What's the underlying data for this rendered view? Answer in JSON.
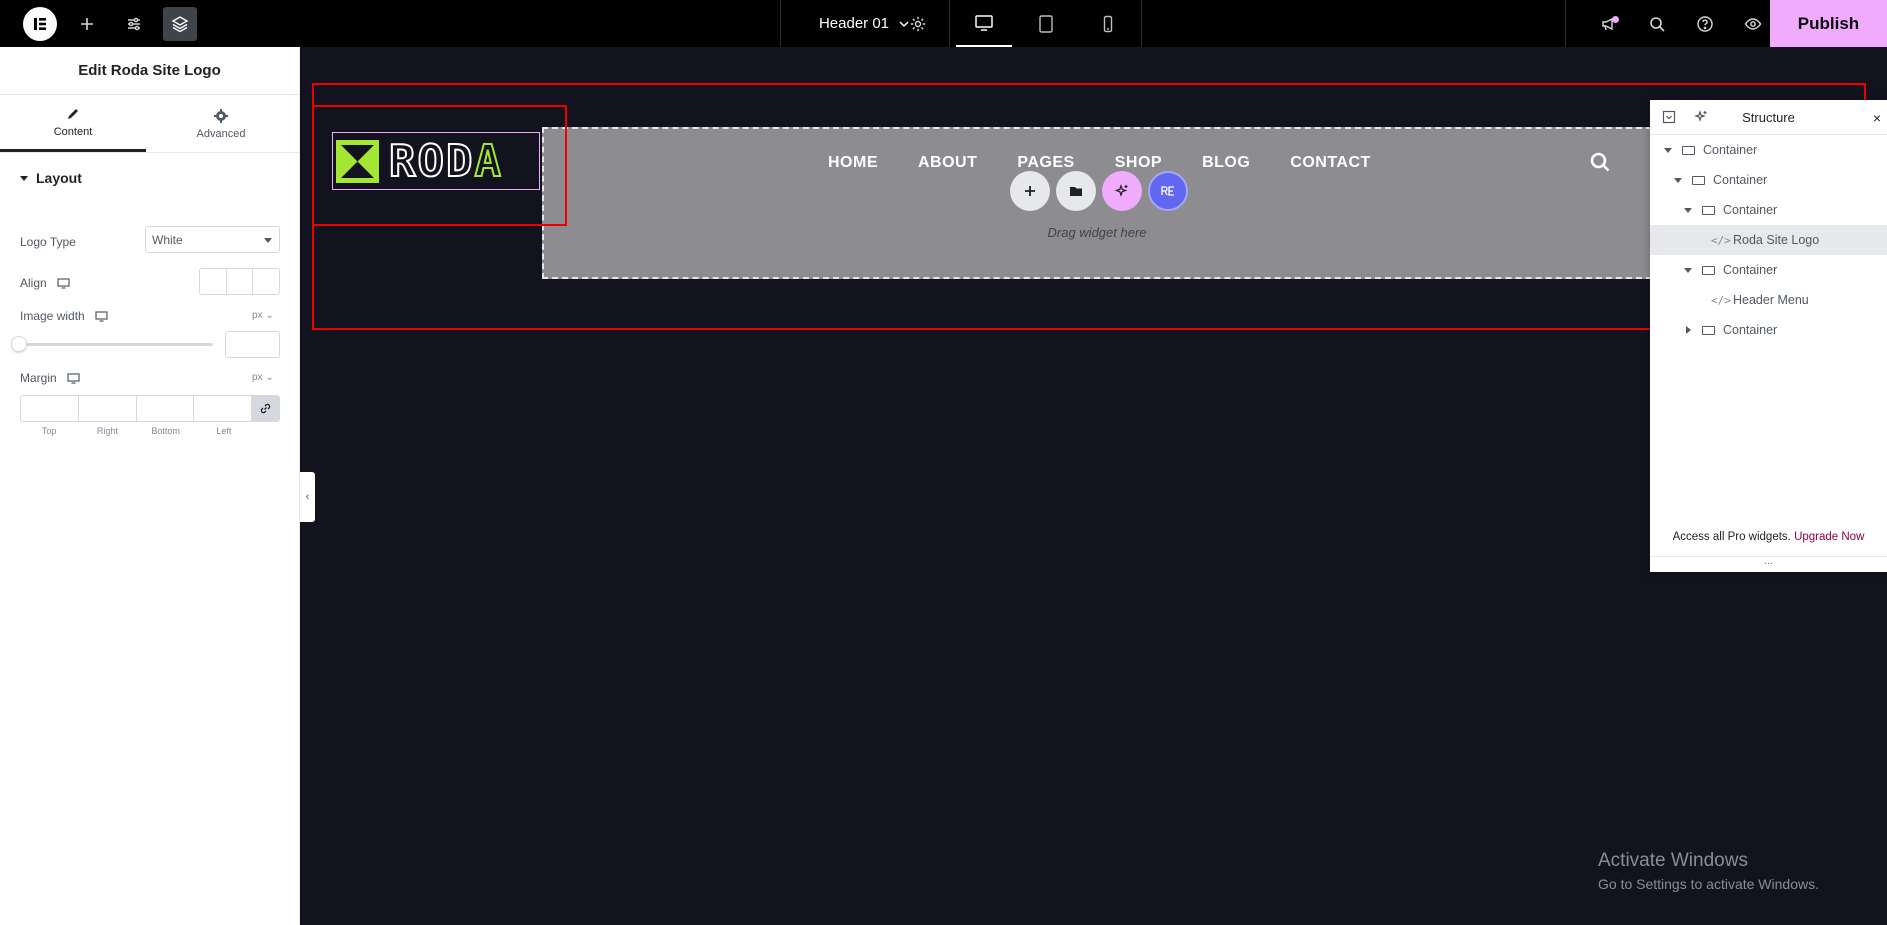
{
  "topbar": {
    "document_title": "Header 01",
    "publish_label": "Publish",
    "icons": [
      "elementor-logo-icon",
      "add-icon",
      "sliders-icon",
      "layers-icon",
      "chevron-down-icon",
      "gear-icon",
      "desktop-icon",
      "tablet-icon",
      "mobile-icon",
      "megaphone-icon",
      "search-icon",
      "help-icon",
      "eye-icon"
    ]
  },
  "panel": {
    "title": "Edit Roda Site Logo",
    "tabs": [
      {
        "label": "Content"
      },
      {
        "label": "Advanced"
      }
    ],
    "section_title": "Layout",
    "logo_type_label": "Logo Type",
    "logo_type_value": "White",
    "align_label": "Align",
    "image_width_label": "Image width",
    "image_width_unit": "px",
    "image_width_value": 0,
    "margin_label": "Margin",
    "margin_unit": "px",
    "margin_sides": [
      "Top",
      "Right",
      "Bottom",
      "Left"
    ]
  },
  "canvas": {
    "logo_text_white": "ROD",
    "logo_text_accent": "A",
    "menu_items": [
      "HOME",
      "ABOUT",
      "PAGES",
      "SHOP",
      "BLOG",
      "CONTACT"
    ],
    "drag_text": "Drag widget here",
    "accent_color": "#a3e635",
    "selection_color": "#e00000"
  },
  "structure": {
    "title": "Structure",
    "items": [
      {
        "label": "Container",
        "type": "container",
        "expanded": true
      },
      {
        "label": "Container",
        "type": "container",
        "expanded": true
      },
      {
        "label": "Container",
        "type": "container",
        "expanded": true
      },
      {
        "label": "Roda Site Logo",
        "type": "widget",
        "selected": true
      },
      {
        "label": "Container",
        "type": "container",
        "expanded": true
      },
      {
        "label": "Header Menu",
        "type": "widget"
      },
      {
        "label": "Container",
        "type": "container",
        "expanded": false
      }
    ],
    "footer_text": "Access all Pro widgets.",
    "footer_link": "Upgrade Now",
    "more": "..."
  },
  "watermark": {
    "line1": "Activate Windows",
    "line2": "Go to Settings to activate Windows."
  }
}
